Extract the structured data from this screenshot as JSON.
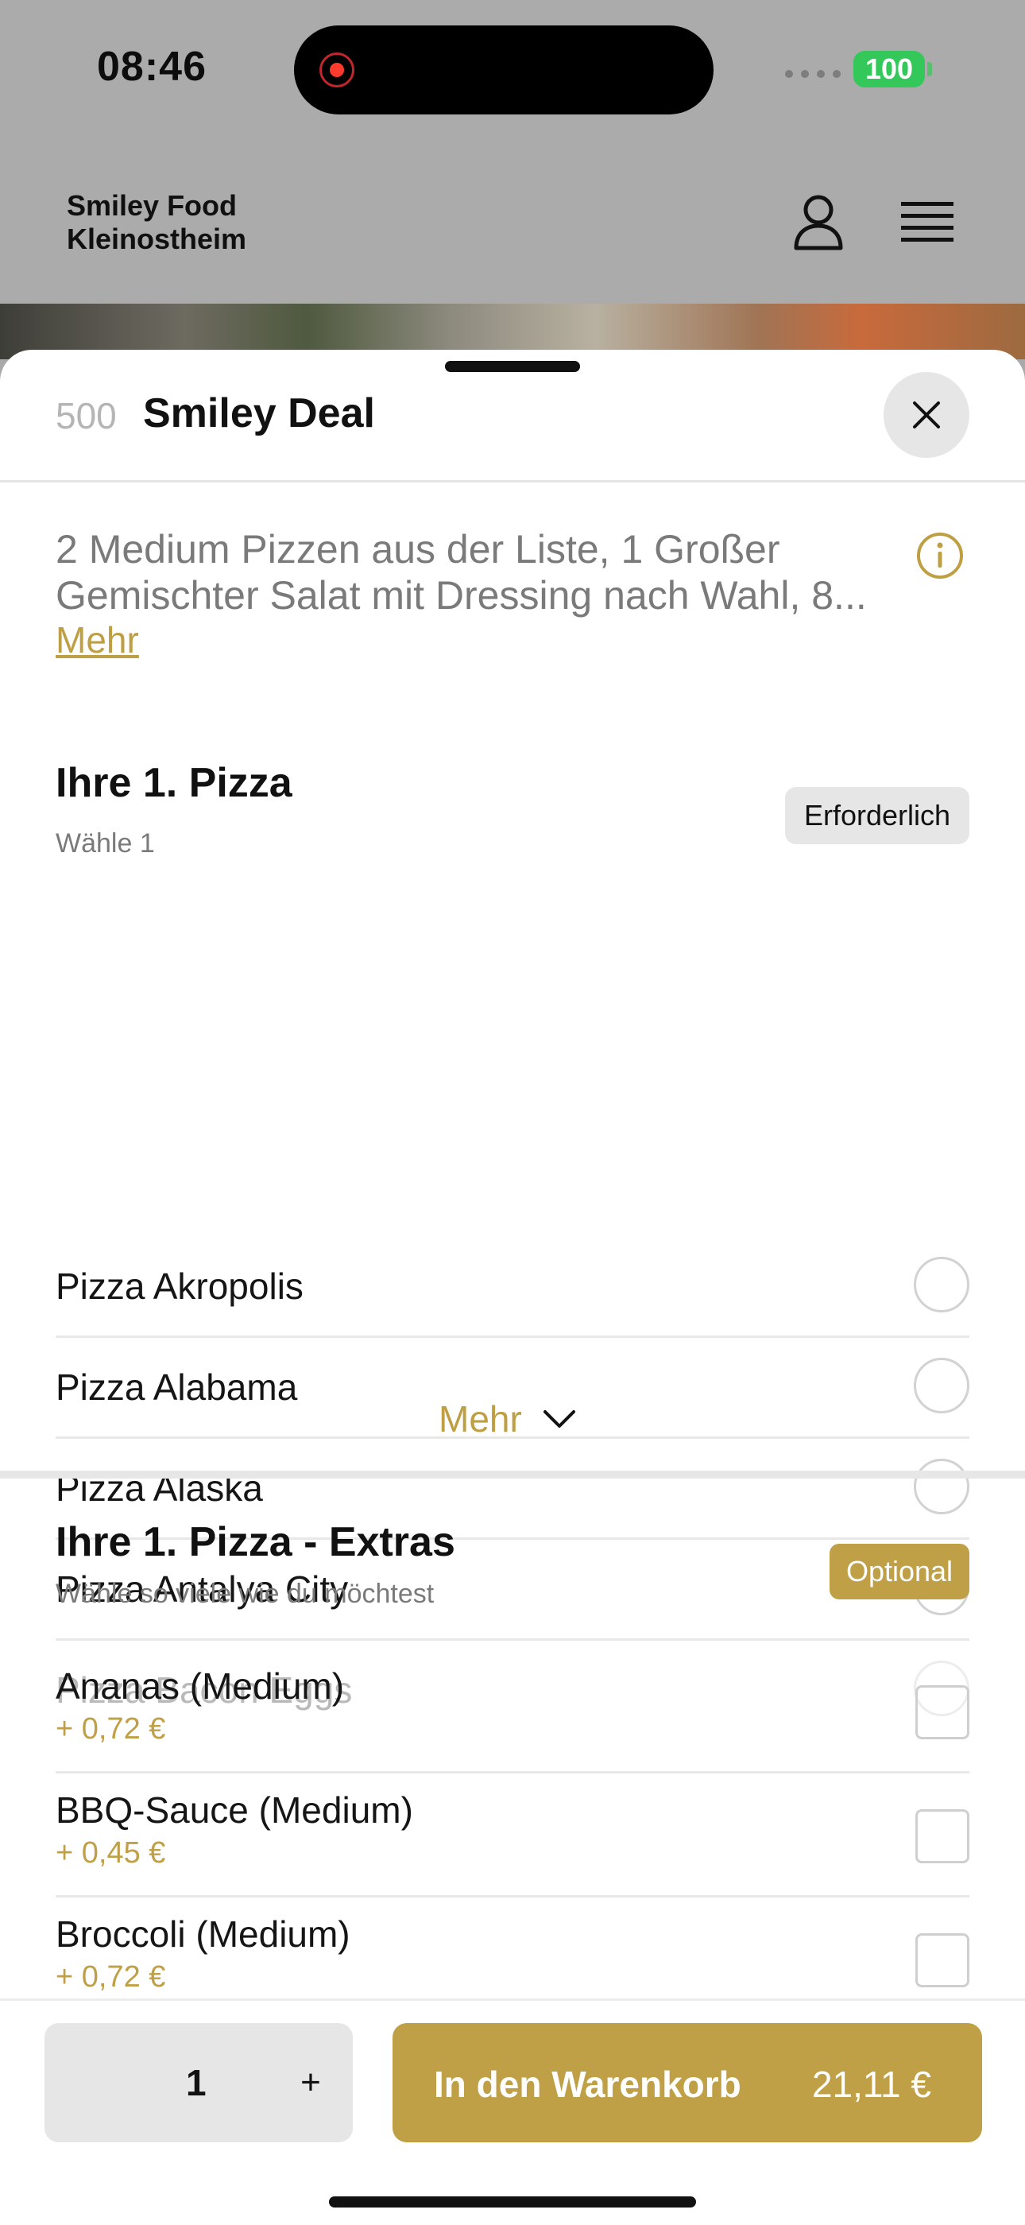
{
  "status_bar": {
    "time": "08:46",
    "battery": "100"
  },
  "background_app": {
    "brand_line1": "Smiley Food",
    "brand_line2": "Kleinostheim"
  },
  "sheet": {
    "number": "500",
    "title": "Smiley Deal",
    "description_line1": "2 Medium Pizzen aus der Liste, 1 Großer",
    "description_line2": "Gemischter Salat mit Dressing nach Wahl, 8...",
    "more_link": "Mehr"
  },
  "pizza_section": {
    "title": "Ihre 1. Pizza",
    "subtitle": "Wähle 1",
    "badge": "Erforderlich",
    "options": [
      "Pizza Akropolis",
      "Pizza Alabama",
      "Pizza Alaska",
      "Pizza Antalya City",
      "Pizza Bacon Eggs"
    ],
    "more_label": "Mehr"
  },
  "extras_section": {
    "title": "Ihre 1. Pizza - Extras",
    "subtitle": "Wähle so viele wie du möchtest",
    "badge": "Optional",
    "items": [
      {
        "label": "Ananas (Medium)",
        "price": "+ 0,72 €"
      },
      {
        "label": "BBQ-Sauce (Medium)",
        "price": "+ 0,45 €"
      },
      {
        "label": "Broccoli (Medium)",
        "price": "+ 0,72 €"
      }
    ]
  },
  "footer": {
    "quantity": "1",
    "plus": "+",
    "cart_label": "In den Warenkorb",
    "cart_price": "21,11 €"
  },
  "colors": {
    "accent": "#c0a046",
    "status_green": "#34c759"
  },
  "icons": [
    "user-icon",
    "hamburger-menu-icon",
    "close-icon",
    "info-icon",
    "chevron-down-icon",
    "record-icon"
  ]
}
